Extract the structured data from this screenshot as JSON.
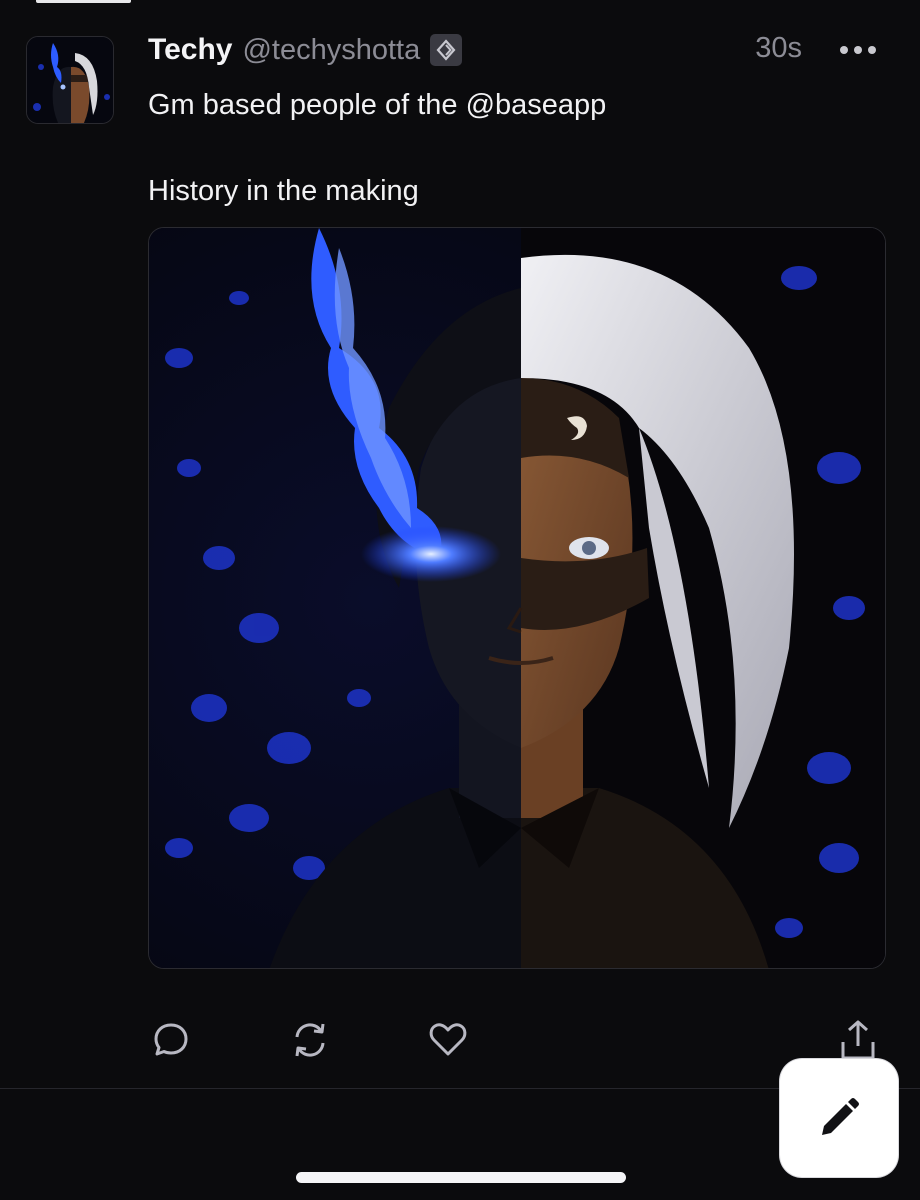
{
  "post": {
    "author": {
      "display_name": "Techy",
      "handle": "@techyshotta",
      "badge_icon": "channel-badge-icon"
    },
    "timestamp": "30s",
    "text_lines": [
      "Gm based people of the @baseapp",
      "",
      "History in the making"
    ],
    "media_icon": "anime-portrait-image",
    "actions": {
      "reply_icon": "reply-icon",
      "recast_icon": "recast-icon",
      "like_icon": "heart-icon",
      "share_icon": "share-icon"
    }
  },
  "compose_icon": "pencil-icon",
  "colors": {
    "background": "#0b0b0d",
    "text": "#f2f2f4",
    "muted": "#8c8c95",
    "compose_bg": "#ffffff"
  }
}
